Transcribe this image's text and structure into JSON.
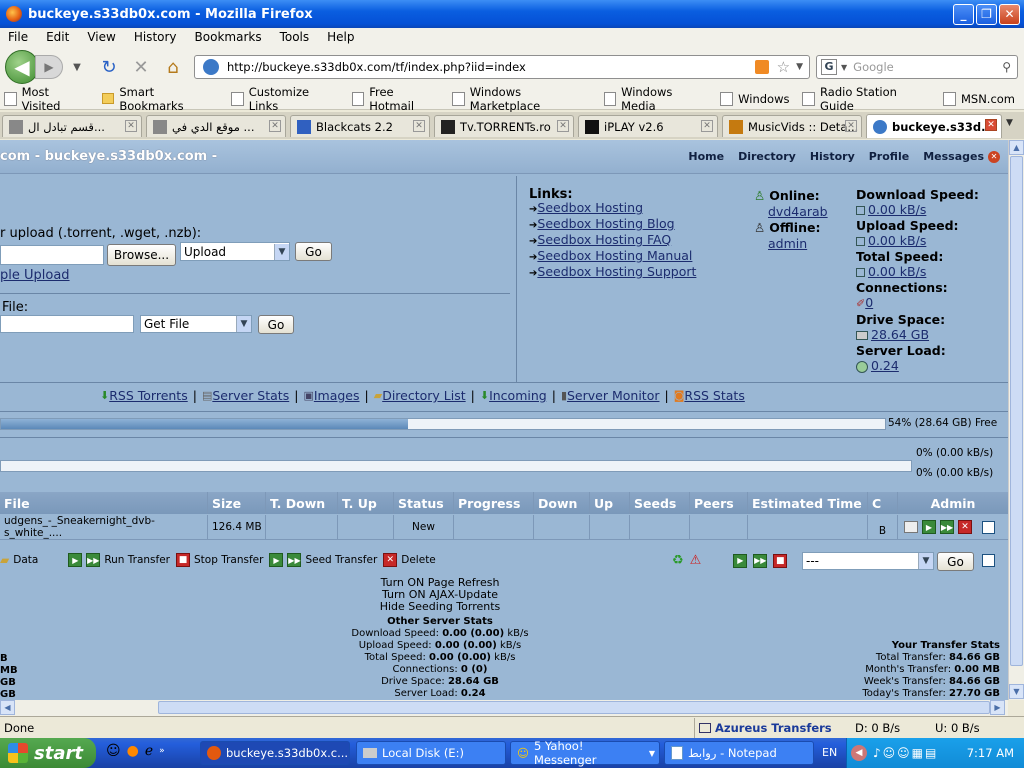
{
  "window": {
    "title": "buckeye.s33db0x.com - Mozilla Firefox"
  },
  "menu": [
    "File",
    "Edit",
    "View",
    "History",
    "Bookmarks",
    "Tools",
    "Help"
  ],
  "nav": {
    "url": "http://buckeye.s33db0x.com/tf/index.php?iid=index",
    "search_placeholder": "Google"
  },
  "bookmarks": [
    "Most Visited",
    "Smart Bookmarks",
    "Customize Links",
    "Free Hotmail",
    "Windows Marketplace",
    "Windows Media",
    "Windows",
    "Radio Station Guide",
    "MSN.com"
  ],
  "tabs": [
    "قسم تبادل ال...",
    "موقع الدي في ...",
    "Blackcats 2.2",
    "Tv.TORRENTs.ro",
    "iPLAY v2.6",
    "MusicVids :: Deta...",
    "buckeye.s33d..."
  ],
  "page": {
    "header_title": "com - buckeye.s33db0x.com -",
    "toplinks": [
      "Home",
      "Directory",
      "History",
      "Profile",
      "Messages"
    ],
    "upload_label": "r upload (.torrent, .wget, .nzb):",
    "browse": "Browse...",
    "upload_select": "Upload",
    "go": "Go",
    "multiple_upload": "ple Upload",
    "file_label": "File:",
    "getfile_select": "Get File",
    "links_title": "Links:",
    "links": [
      "Seedbox Hosting",
      "Seedbox Hosting Blog",
      "Seedbox Hosting FAQ",
      "Seedbox Hosting Manual",
      "Seedbox Hosting Support"
    ],
    "online_label": "Online:",
    "online_user": "dvd4arab",
    "offline_label": "Offline:",
    "offline_user": "admin",
    "stats": [
      {
        "label": "Download Speed:",
        "value": "0.00 kB/s"
      },
      {
        "label": "Upload Speed:",
        "value": "0.00 kB/s"
      },
      {
        "label": "Total Speed:",
        "value": "0.00 kB/s"
      },
      {
        "label": "Connections:",
        "value": "0"
      },
      {
        "label": "Drive Space:",
        "value": "28.64 GB"
      },
      {
        "label": "Server Load:",
        "value": "0.24"
      }
    ],
    "toolbar": [
      "RSS Torrents",
      "Server Stats",
      "Images",
      "Directory List",
      "Incoming",
      "Server Monitor",
      "RSS Stats"
    ],
    "drive_bar": {
      "fraction_used": 0.46,
      "label": "54% (28.64 GB) Free"
    },
    "speed_bar1": {
      "fraction": 0,
      "label": "0% (0.00 kB/s)"
    },
    "speed_bar2": {
      "fraction": 0,
      "label": "0% (0.00 kB/s)"
    },
    "table": {
      "headers": [
        "File",
        "Size",
        "T. Down",
        "T. Up",
        "Status",
        "Progress",
        "Down",
        "Up",
        "Seeds",
        "Peers",
        "Estimated Time",
        "C",
        "Admin"
      ],
      "row": {
        "file": "udgens_-_Sneakernight_dvb-s_white_....",
        "size": "126.4 MB",
        "status": "New",
        "c": "B"
      }
    },
    "actions": [
      "Data",
      "Run Transfer",
      "Stop Transfer",
      "Seed Transfer",
      "Delete"
    ],
    "bulk_select": "---",
    "options": [
      "Turn ON Page Refresh",
      "Turn ON AJAX-Update",
      "Hide Seeding Torrents"
    ],
    "other_stats_title": "Other Server Stats",
    "other_stats": [
      {
        "label": "Download Speed:",
        "value": "0.00 (0.00)",
        "unit": "kB/s"
      },
      {
        "label": "Upload Speed:",
        "value": "0.00 (0.00)",
        "unit": "kB/s"
      },
      {
        "label": "Total Speed:",
        "value": "0.00 (0.00)",
        "unit": "kB/s"
      },
      {
        "label": "Connections:",
        "value": "0 (0)",
        "unit": ""
      },
      {
        "label": "Drive Space:",
        "value": "28.64 GB",
        "unit": ""
      },
      {
        "label": "Server Load:",
        "value": "0.24",
        "unit": ""
      }
    ],
    "left_fragments": [
      "B",
      "MB",
      "GB",
      "GB"
    ],
    "transfer_title": "Your Transfer Stats",
    "transfer_stats": [
      {
        "label": "Total Transfer:",
        "value": "84.66 GB"
      },
      {
        "label": "Month's Transfer:",
        "value": "0.00 MB"
      },
      {
        "label": "Week's Transfer:",
        "value": "84.66 GB"
      },
      {
        "label": "Today's Transfer:",
        "value": "27.70 GB"
      }
    ]
  },
  "statusbar": {
    "text": "Done",
    "ext_title": "Azureus Transfers",
    "down": "D: 0 B/s",
    "up": "U: 0 B/s"
  },
  "taskbar": {
    "start": "start",
    "tasks": [
      "buckeye.s33db0x.c...",
      "Local Disk (E:)",
      "5 Yahoo! Messenger",
      "روابط - Notepad"
    ],
    "lang": "EN",
    "time": "7:17 AM"
  },
  "colors": {
    "page_bg": "#9ab7d4",
    "title_bar": "#0551d6",
    "taskbar": "#245edb"
  }
}
